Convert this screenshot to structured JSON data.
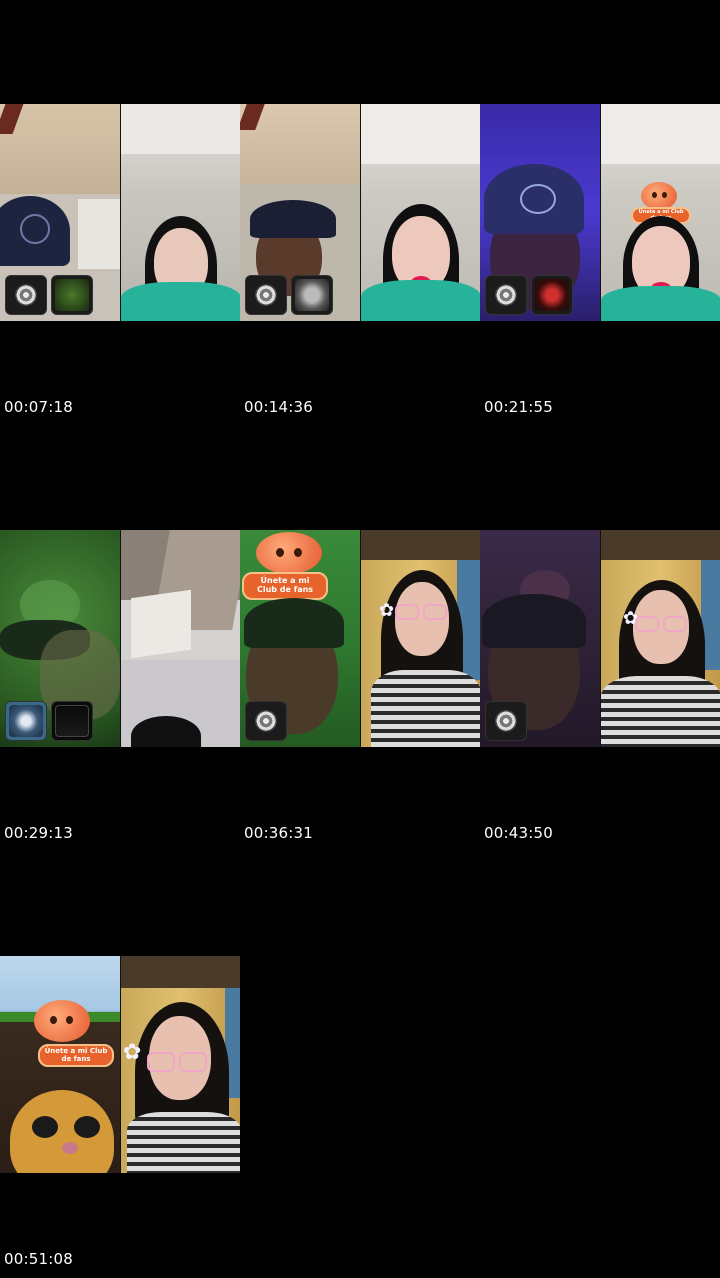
{
  "timestamps": [
    "00:07:18",
    "00:14:36",
    "00:21:55",
    "00:29:13",
    "00:36:31",
    "00:43:50",
    "00:51:08"
  ],
  "tiles": [
    {
      "left_scene": "man-cap-room",
      "right_scene": "girl-green-hoodie",
      "thumbs": [
        "disc-icon",
        "avatar-pic"
      ]
    },
    {
      "left_scene": "man-cap-room",
      "right_scene": "girl-green-hoodie",
      "thumbs": [
        "disc-icon",
        "avatar-pic"
      ]
    },
    {
      "left_scene": "man-purple-light",
      "right_scene": "girl-green-hoodie-badge",
      "thumbs": [
        "disc-icon",
        "avatar-pic"
      ]
    },
    {
      "left_scene": "green-blur",
      "right_scene": "ceiling-corner",
      "thumbs": [
        "avatar-pic",
        "logo-pic"
      ]
    },
    {
      "left_scene": "man-green-light-badge",
      "right_scene": "woman-glasses-flower",
      "thumbs": [
        "disc-icon"
      ]
    },
    {
      "left_scene": "man-dark-purple",
      "right_scene": "woman-glasses-flower",
      "thumbs": [
        "disc-icon"
      ]
    },
    {
      "left_scene": "mascot-ground",
      "right_scene": "woman-glasses-flower",
      "thumbs": []
    }
  ],
  "badge": {
    "label": "Únete a mi Club de fans"
  },
  "colors": {
    "background": "#000000",
    "hoodie": "#27b39a",
    "badge": "#e8632c"
  }
}
